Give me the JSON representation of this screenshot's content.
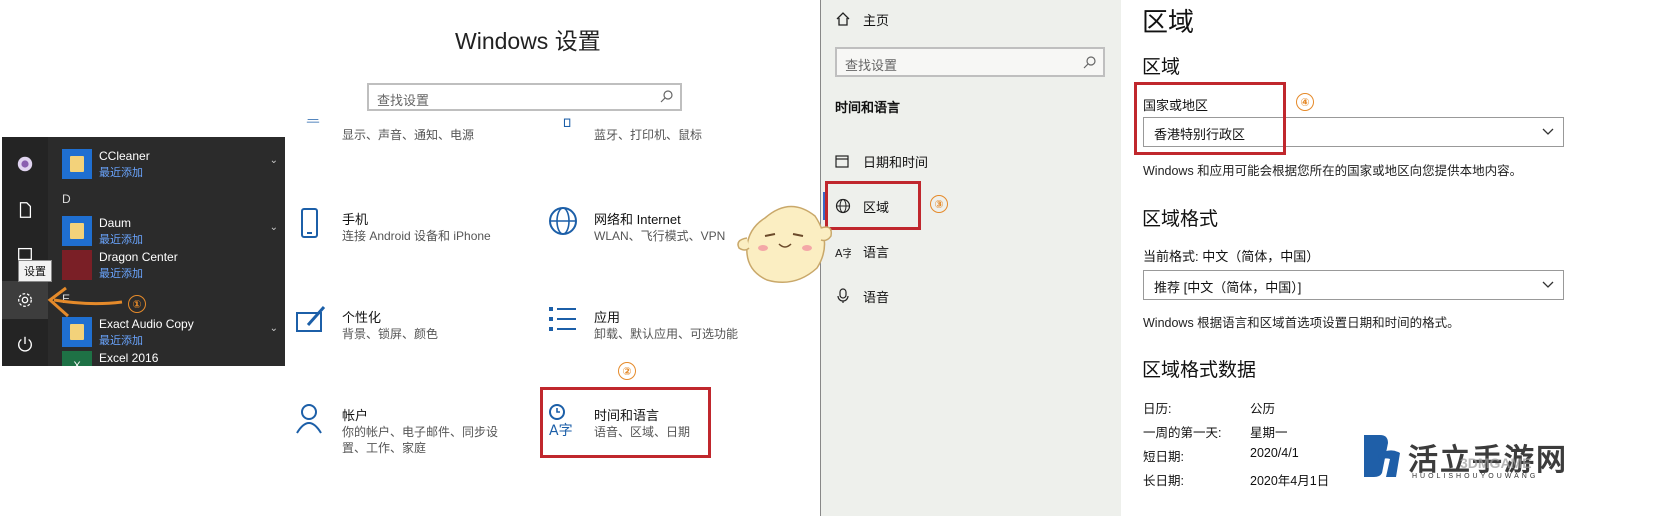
{
  "start_menu": {
    "tooltip": "设置",
    "letter_d": "D",
    "letter_e": "E",
    "items": [
      {
        "name": "CCleaner",
        "sub": "最近添加"
      },
      {
        "name": "Daum",
        "sub": "最近添加"
      },
      {
        "name": "Dragon Center",
        "sub": "最近添加"
      },
      {
        "name": "Exact Audio Copy",
        "sub": "最近添加"
      },
      {
        "name": "Excel 2016",
        "sub": ""
      }
    ]
  },
  "windows_settings": {
    "title": "Windows 设置",
    "search_placeholder": "查找设置",
    "categories": {
      "system": {
        "desc": "显示、声音、通知、电源"
      },
      "devices": {
        "desc": "蓝牙、打印机、鼠标"
      },
      "phone": {
        "name": "手机",
        "desc": "连接 Android 设备和 iPhone"
      },
      "network": {
        "name": "网络和 Internet",
        "desc": "WLAN、飞行模式、VPN"
      },
      "personalization": {
        "name": "个性化",
        "desc": "背景、锁屏、颜色"
      },
      "apps": {
        "name": "应用",
        "desc": "卸载、默认应用、可选功能"
      },
      "accounts": {
        "name": "帐户",
        "desc1": "你的帐户、电子邮件、同步设",
        "desc2": "置、工作、家庭"
      },
      "time_language": {
        "name": "时间和语言",
        "desc": "语音、区域、日期"
      }
    }
  },
  "markers": [
    "①",
    "②",
    "③",
    "④"
  ],
  "nav_pane": {
    "home": "主页",
    "search_placeholder": "查找设置",
    "section": "时间和语言",
    "items": [
      "日期和时间",
      "区域",
      "语言",
      "语音"
    ]
  },
  "region_page": {
    "title": "区域",
    "section_region": "区域",
    "country_label": "国家或地区",
    "country_value": "香港特别行政区",
    "country_help": "Windows 和应用可能会根据您所在的国家或地区向您提供本地内容。",
    "section_format": "区域格式",
    "current_format": "当前格式: 中文（简体，中国）",
    "format_value": "推荐 [中文（简体，中国）]",
    "format_help": "Windows 根据语言和区域首选项设置日期和时间的格式。",
    "section_format_data": "区域格式数据",
    "format_data": [
      {
        "key": "日历:",
        "value": "公历"
      },
      {
        "key": "一周的第一天:",
        "value": "星期一"
      },
      {
        "key": "短日期:",
        "value": "2020/4/1"
      },
      {
        "key": "长日期:",
        "value": "2020年4月1日"
      }
    ]
  },
  "watermark": {
    "text": "活立手游网",
    "sub": "HUOLISHOUYOUWANG",
    "brand": "3DMGAME"
  },
  "colors": {
    "highlight_red": "#c0272d",
    "marker_orange": "#e58a2a",
    "accent_blue": "#3a67c6"
  }
}
